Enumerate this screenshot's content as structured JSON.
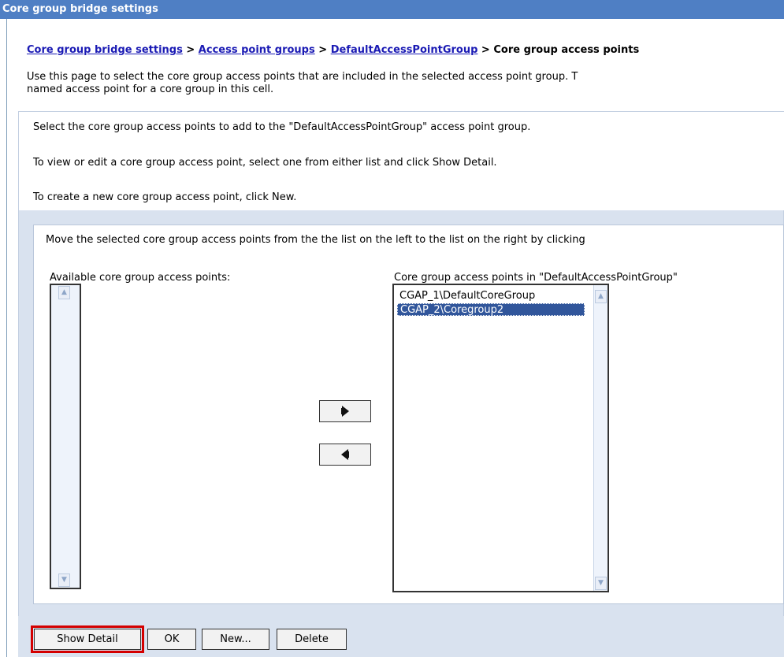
{
  "window": {
    "title": "Core group bridge settings"
  },
  "breadcrumb": {
    "items": [
      "Core group bridge settings",
      "Access point groups",
      "DefaultAccessPointGroup"
    ],
    "separator": ">",
    "current": "Core group access points"
  },
  "intro": {
    "line1": "Use this page to select the core group access points that are included in the selected access point group. T",
    "line2": "named access point for a core group in this cell."
  },
  "instructions": [
    "Select the core group access points to add to the \"DefaultAccessPointGroup\" access point group.",
    "To view or edit a core group access point, select one from either list and click Show Detail.",
    "To create a new core group access point, click New."
  ],
  "move_panel": {
    "text": "Move the selected core group access points from the the list on the left to the list on the right by clicking",
    "available_label": "Available core group access points:",
    "selected_label": "Core group access points in \"DefaultAccessPointGroup\"",
    "available_items": [],
    "selected_items": [
      {
        "label": "CGAP_1\\DefaultCoreGroup",
        "selected": false
      },
      {
        "label": "CGAP_2\\Coregroup2",
        "selected": true
      }
    ]
  },
  "buttons": {
    "show_detail": "Show Detail",
    "ok": "OK",
    "new": "New...",
    "delete": "Delete"
  },
  "colors": {
    "titlebar": "#4f7fc4",
    "panel_bg": "#d9e2ef",
    "selection": "#31569b",
    "highlight": "#d40000",
    "link": "#1a1ab4"
  }
}
